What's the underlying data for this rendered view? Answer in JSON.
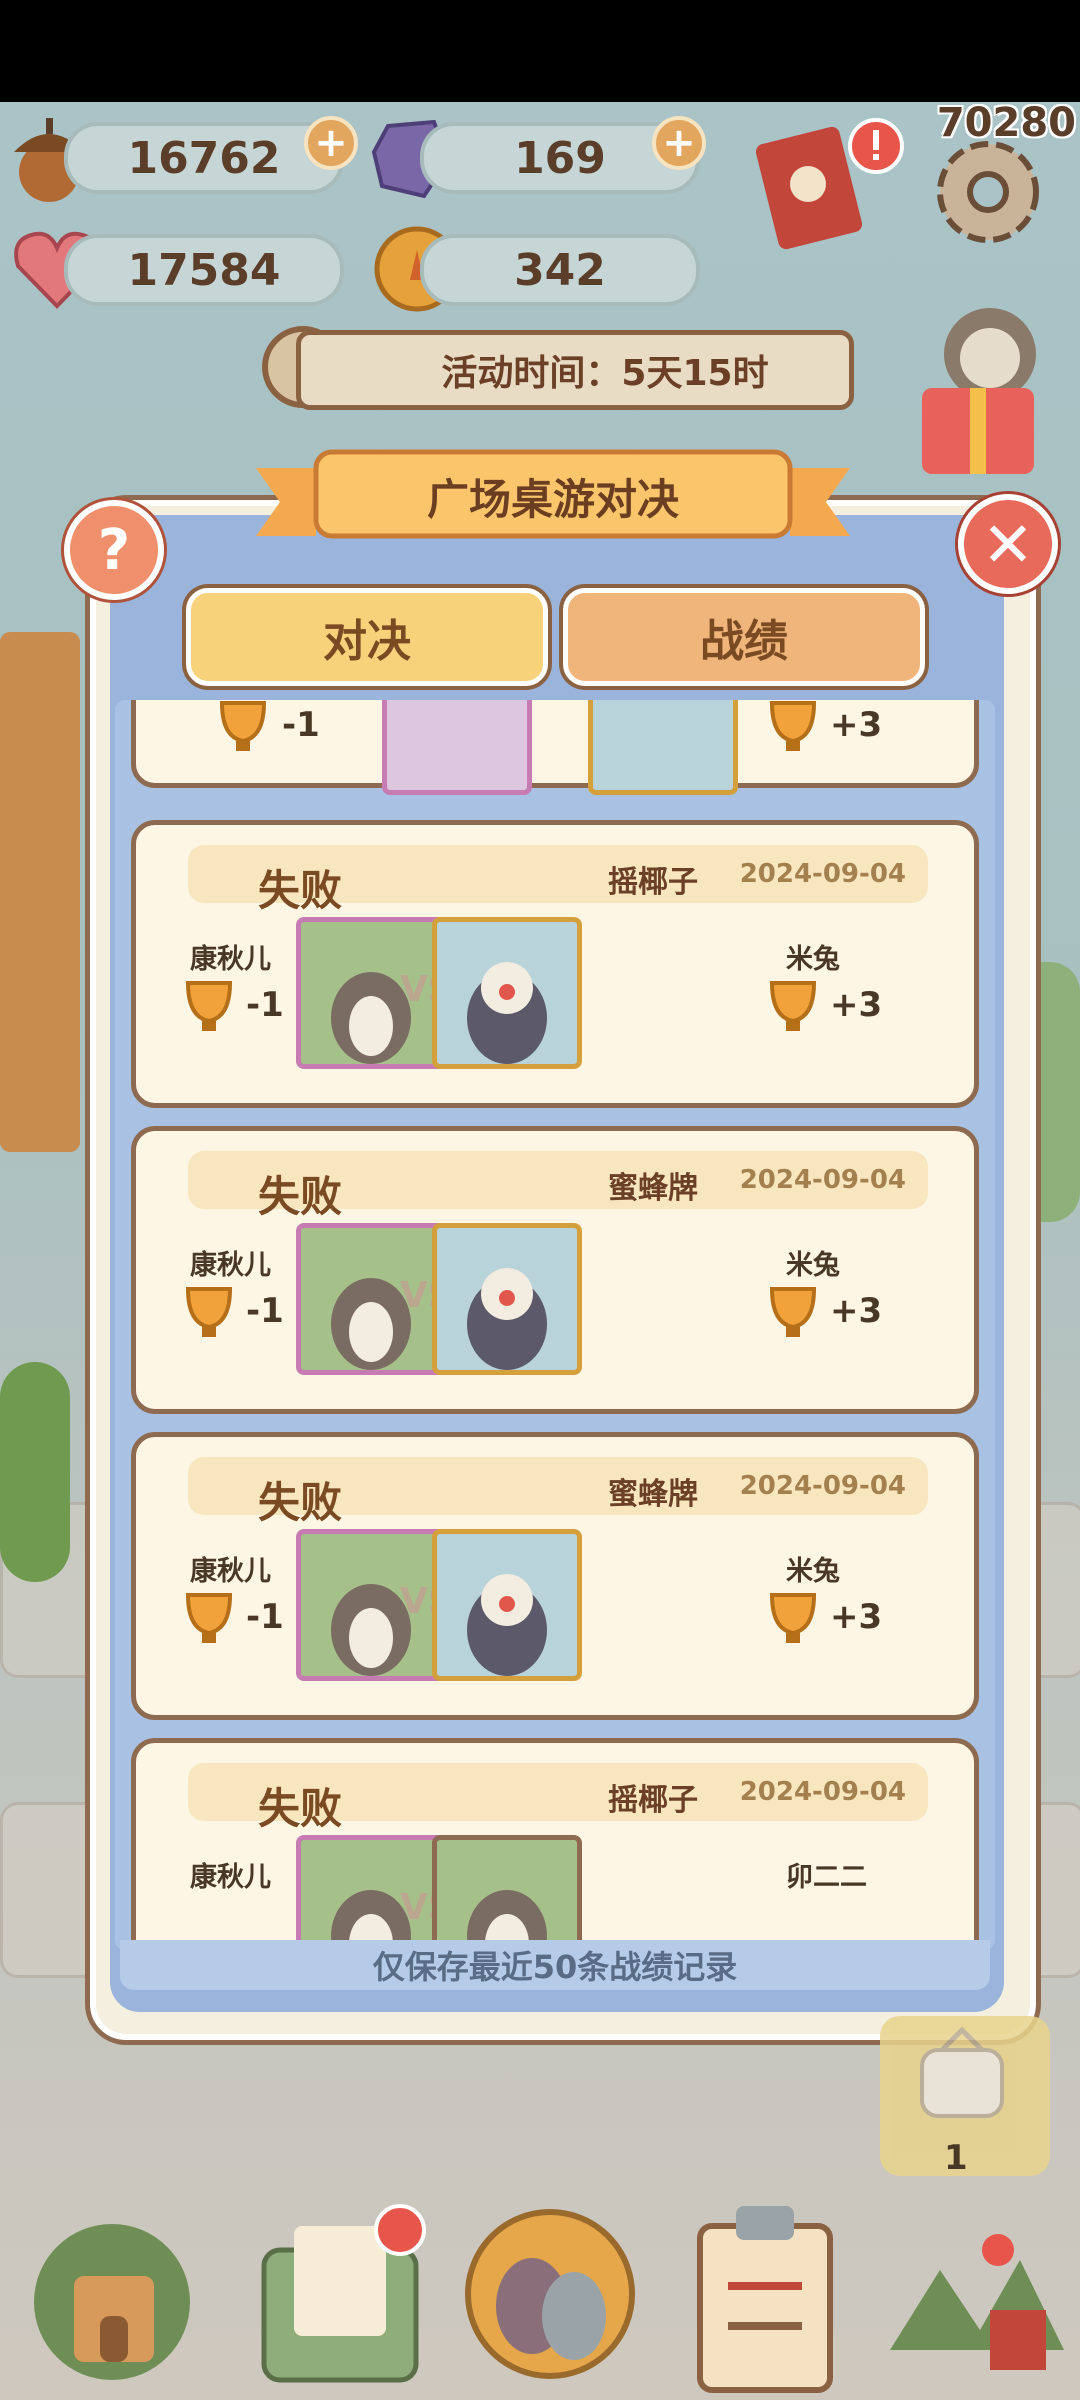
{
  "resources": {
    "acorn": {
      "value": "16762",
      "icon": "acorn-icon"
    },
    "crystal": {
      "value": "169",
      "icon": "crystal-icon"
    },
    "heart": {
      "value": "17584",
      "icon": "heart-gem-icon"
    },
    "coin": {
      "value": "342",
      "icon": "carrot-coin-icon"
    },
    "plus": "+"
  },
  "score": "70280",
  "event_timer": "活动时间：5天15时",
  "panel": {
    "title": "广场桌游对决",
    "help": "?",
    "close": "✕",
    "tabs": [
      {
        "label": "对决",
        "selected": false
      },
      {
        "label": "战绩",
        "selected": true
      }
    ],
    "footer_note": "仅保存最近50条战绩记录"
  },
  "vs_label": "VS",
  "partial_top": {
    "left_delta": "-1",
    "right_delta": "+3"
  },
  "records": [
    {
      "result": "失败",
      "mode": "摇椰子",
      "date": "2024-09-04",
      "left_player": "康秋儿",
      "left_delta": "-1",
      "right_player": "米兔",
      "right_delta": "+3"
    },
    {
      "result": "失败",
      "mode": "蜜蜂牌",
      "date": "2024-09-04",
      "left_player": "康秋儿",
      "left_delta": "-1",
      "right_player": "米兔",
      "right_delta": "+3"
    },
    {
      "result": "失败",
      "mode": "蜜蜂牌",
      "date": "2024-09-04",
      "left_player": "康秋儿",
      "left_delta": "-1",
      "right_player": "米兔",
      "right_delta": "+3"
    },
    {
      "result": "失败",
      "mode": "摇椰子",
      "date": "2024-09-04",
      "left_player": "康秋儿",
      "left_delta": "",
      "right_player": "卯二二",
      "right_delta": ""
    }
  ],
  "inventory_count": "1",
  "colors": {
    "panel_blue": "#9ab4dc",
    "card_bg": "#fdf6e4",
    "tab_selected": "#f0b57a",
    "tab_normal": "#f7d27a",
    "brown": "#8e6b50"
  }
}
